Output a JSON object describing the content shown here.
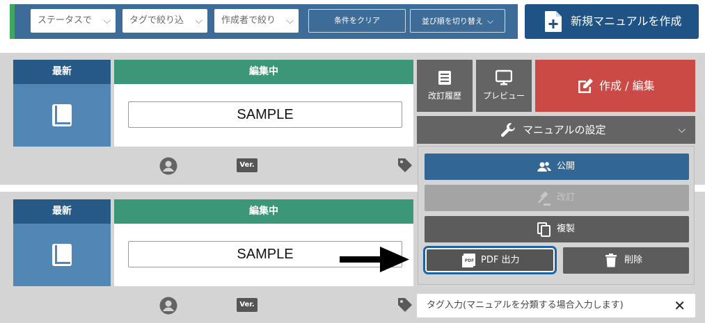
{
  "filters": {
    "status_label": "ステータスで",
    "tag_label": "タグで絞り込",
    "author_label": "作成者で絞り",
    "clear_label": "条件をクリア",
    "sort_label": "並び順を切り替え"
  },
  "new_manual_label": "新規マニュアルを作成",
  "cards": [
    {
      "latest_label": "最新",
      "editing_label": "編集中",
      "title": "SAMPLE",
      "ver_badge": "Ver.",
      "history_label": "改訂履歴",
      "preview_label": "プレビュー",
      "edit_label": "作成 / 編集",
      "settings_label": "マニュアルの設定"
    },
    {
      "latest_label": "最新",
      "editing_label": "編集中",
      "title": "SAMPLE",
      "ver_badge": "Ver.",
      "tag_placeholder": "タグ入力(マニュアルを分類する場合入力します)"
    }
  ],
  "settings_menu": {
    "publish": "公開",
    "revise": "改訂",
    "copy": "複製",
    "pdf": "PDF 出力",
    "delete": "削除"
  },
  "colors": {
    "accent_green": "#41a65e",
    "filter_bg": "#3d6c99",
    "new_button": "#1f5386",
    "edit_red": "#cc4a45",
    "highlight_border": "#1e65a8"
  }
}
